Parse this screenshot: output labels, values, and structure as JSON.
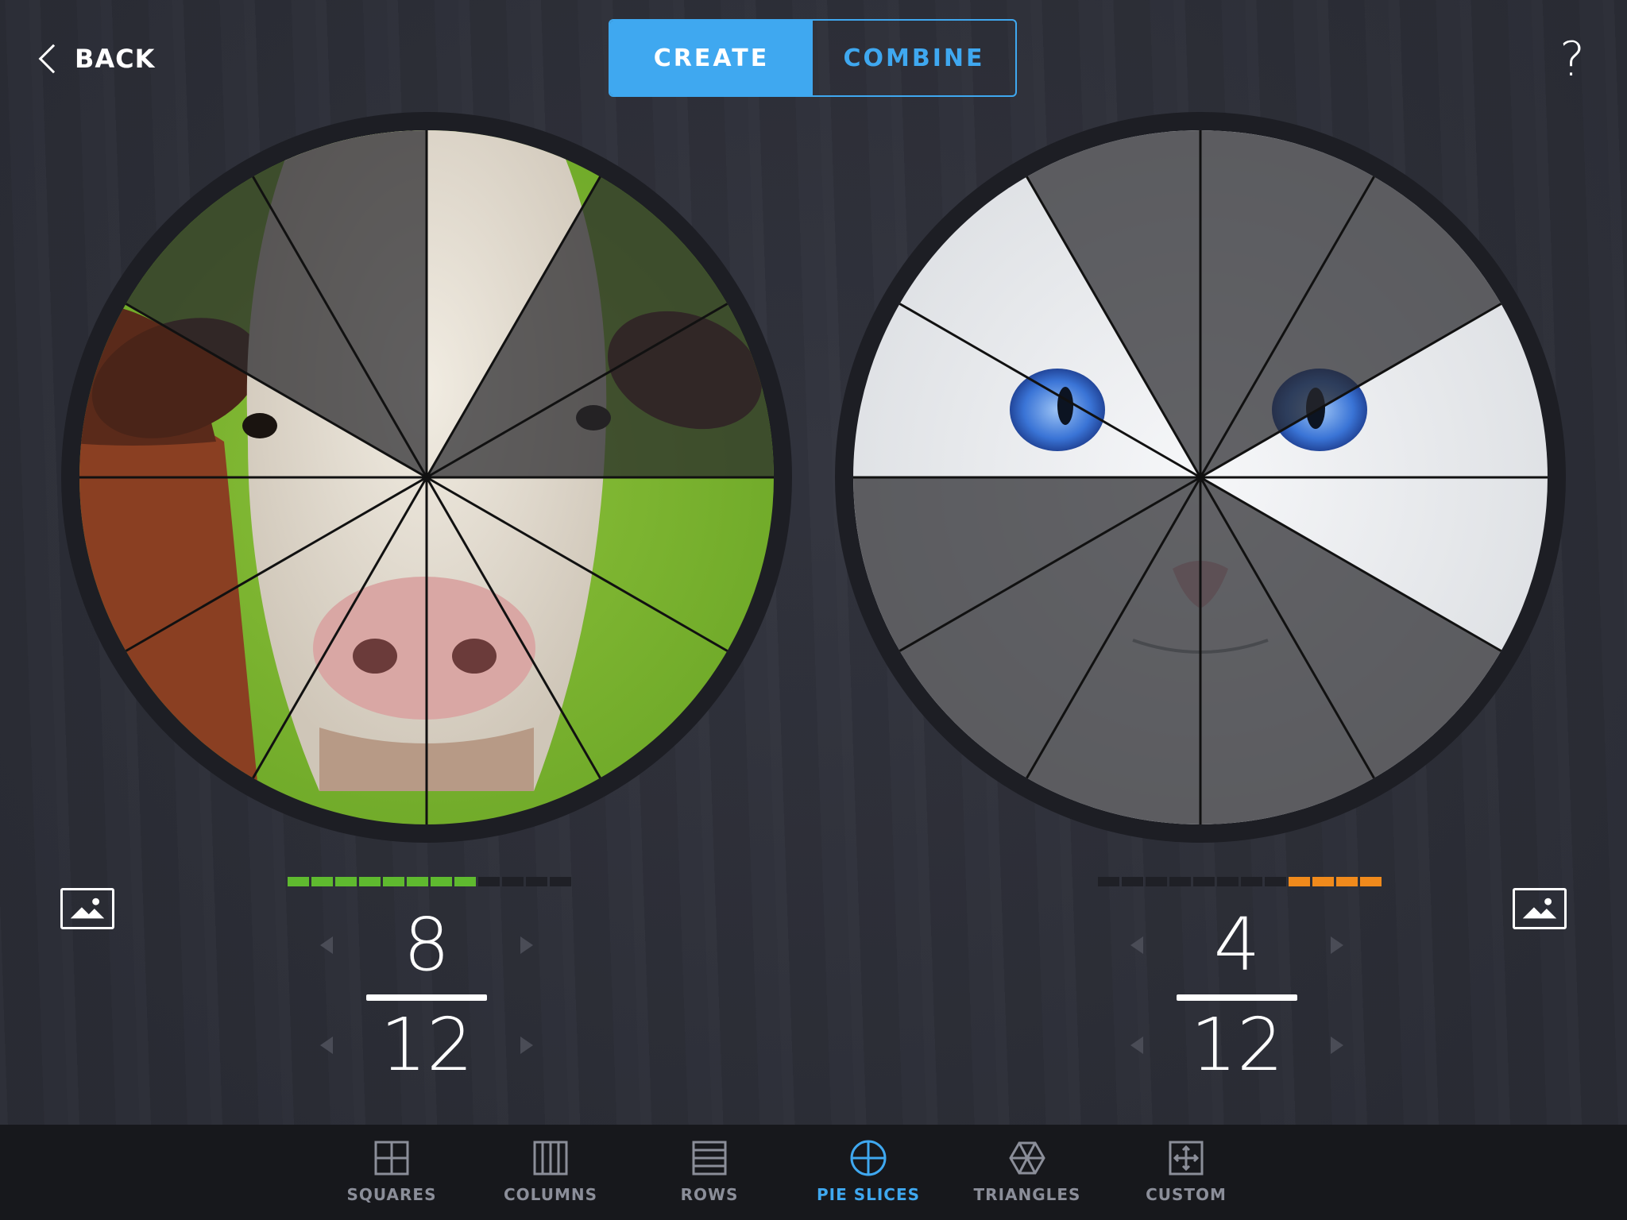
{
  "header": {
    "back_label": "BACK",
    "tabs": [
      {
        "label": "CREATE",
        "active": true
      },
      {
        "label": "COMBINE",
        "active": false
      }
    ],
    "help_label": "?"
  },
  "left_panel": {
    "image_subject": "cow face",
    "slices_total": 12,
    "slices_selected": 8,
    "numerator": "8",
    "denominator": "12",
    "meter_color": "#5fba2f",
    "meter_filled": 8,
    "meter_total": 12
  },
  "right_panel": {
    "image_subject": "white cat with blue eyes",
    "slices_total": 12,
    "slices_selected": 4,
    "numerator": "4",
    "denominator": "12",
    "meter_color": "#f08a1c",
    "meter_filled": 4,
    "meter_total": 12
  },
  "colors": {
    "accent": "#3fa8f0",
    "background": "#2e303a",
    "tabbar": "#17181c",
    "meter_empty": "#1f2026"
  },
  "tabbar": {
    "items": [
      {
        "label": "SQUARES",
        "icon": "squares-icon",
        "active": false
      },
      {
        "label": "COLUMNS",
        "icon": "columns-icon",
        "active": false
      },
      {
        "label": "ROWS",
        "icon": "rows-icon",
        "active": false
      },
      {
        "label": "PIE SLICES",
        "icon": "pie-slices-icon",
        "active": true
      },
      {
        "label": "TRIANGLES",
        "icon": "triangles-icon",
        "active": false
      },
      {
        "label": "CUSTOM",
        "icon": "custom-icon",
        "active": false
      }
    ]
  }
}
